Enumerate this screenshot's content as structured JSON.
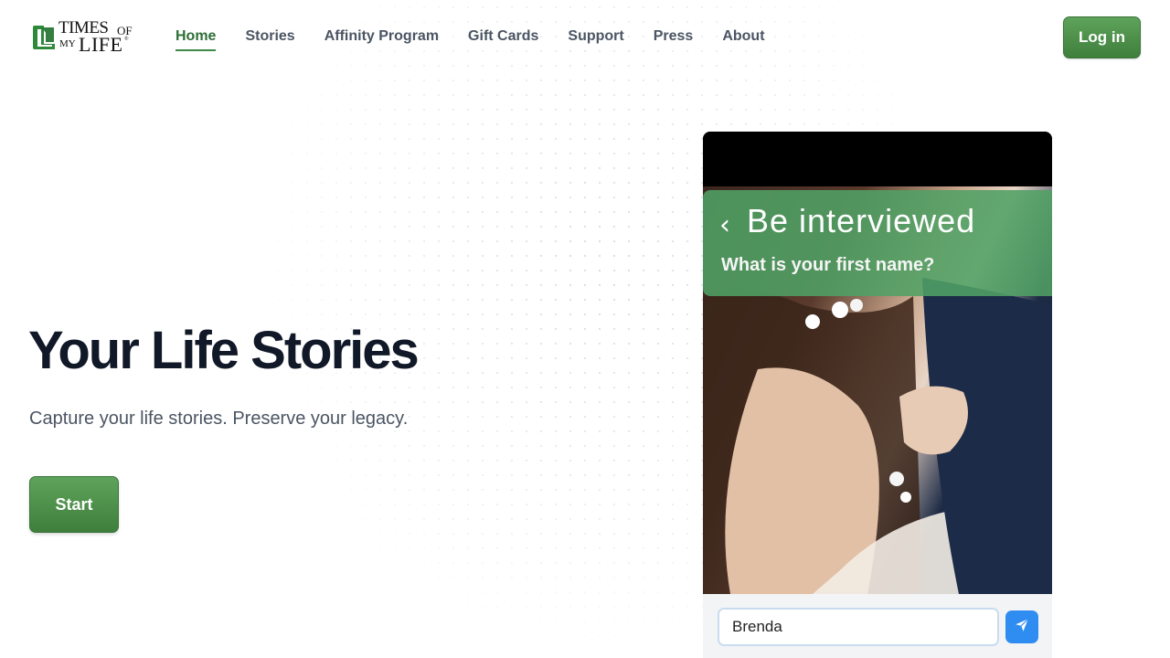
{
  "header": {
    "logo": {
      "line1": "TIMES",
      "of": "OF",
      "my": "MY",
      "life": "LIFE",
      "mark": "®"
    },
    "nav": [
      {
        "label": "Home",
        "active": true
      },
      {
        "label": "Stories"
      },
      {
        "label": "Affinity Program"
      },
      {
        "label": "Gift Cards"
      },
      {
        "label": "Support"
      },
      {
        "label": "Press"
      },
      {
        "label": "About"
      }
    ],
    "login_label": "Log in"
  },
  "hero": {
    "title": "Your Life Stories",
    "subtitle": "Capture your life stories. Preserve your legacy.",
    "start_label": "Start"
  },
  "phone": {
    "back_icon": "chevron-left-icon",
    "banner_title": "Be interviewed",
    "question": "What is your first name?",
    "input_value": "Brenda",
    "send_icon": "send-icon"
  },
  "colors": {
    "brand_green": "#4a8f47",
    "nav_active": "#2f6e38",
    "send_blue": "#2f8df2",
    "title": "#111827"
  }
}
